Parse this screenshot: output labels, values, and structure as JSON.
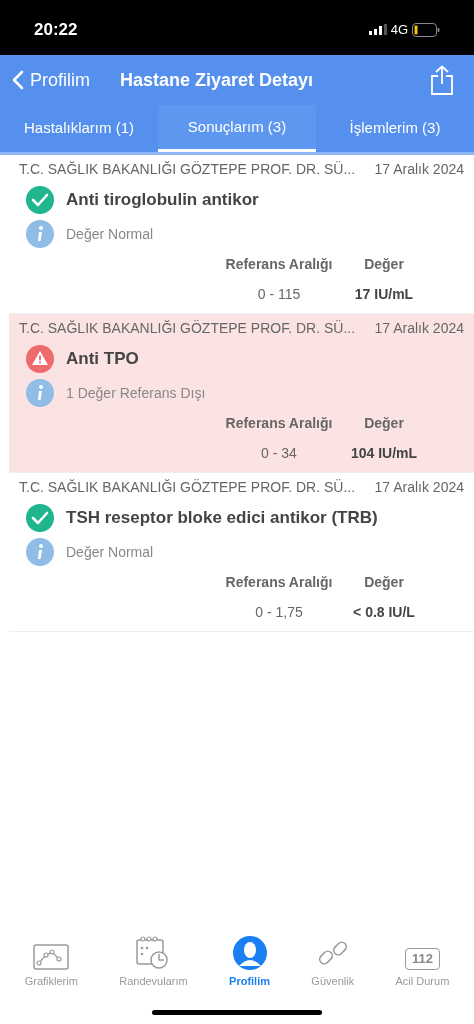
{
  "status_bar": {
    "time": "20:22",
    "network": "4G"
  },
  "nav": {
    "back_label": "Profilim",
    "title": "Hastane Ziyaret Detayı"
  },
  "tabs": [
    {
      "label": "Hastalıklarım (1)",
      "selected": false
    },
    {
      "label": "Sonuçlarım (3)",
      "selected": true
    },
    {
      "label": "İşlemlerim (3)",
      "selected": false
    }
  ],
  "results": [
    {
      "hospital": "T.C. SAĞLIK BAKANLIĞI GÖZTEPE PROF. DR. SÜ...",
      "date": "17 Aralık 2024",
      "kind": "normal",
      "test": "Anti tiroglobulin antikor",
      "note": "Değer Normal",
      "range_header": "Referans Aralığı",
      "value_header": "Değer",
      "range": "0 - 115",
      "value": "17 IU/mL"
    },
    {
      "hospital": "T.C. SAĞLIK BAKANLIĞI GÖZTEPE PROF. DR. SÜ...",
      "date": "17 Aralık 2024",
      "kind": "abnormal",
      "test": "Anti TPO",
      "note": "1 Değer Referans Dışı",
      "range_header": "Referans Aralığı",
      "value_header": "Değer",
      "range": "0 - 34",
      "value": "104 IU/mL"
    },
    {
      "hospital": "T.C. SAĞLIK BAKANLIĞI GÖZTEPE PROF. DR. SÜ...",
      "date": "17 Aralık 2024",
      "kind": "normal",
      "test": "TSH reseptor bloke edici antikor (TRB)",
      "note": "Değer Normal",
      "range_header": "Referans Aralığı",
      "value_header": "Değer",
      "range": "0 - 1,75",
      "value": "< 0.8 IU/L"
    }
  ],
  "bottom_tabs": [
    {
      "kind": "chart",
      "label": "Grafiklerim",
      "selected": false
    },
    {
      "kind": "calendar",
      "label": "Randevularım",
      "selected": false
    },
    {
      "kind": "profile",
      "label": "Profilim",
      "selected": true
    },
    {
      "kind": "link",
      "label": "Güvenlik",
      "selected": false
    },
    {
      "kind": "emergency",
      "label": "Acil Durum",
      "icon_text": "112",
      "selected": false
    }
  ]
}
